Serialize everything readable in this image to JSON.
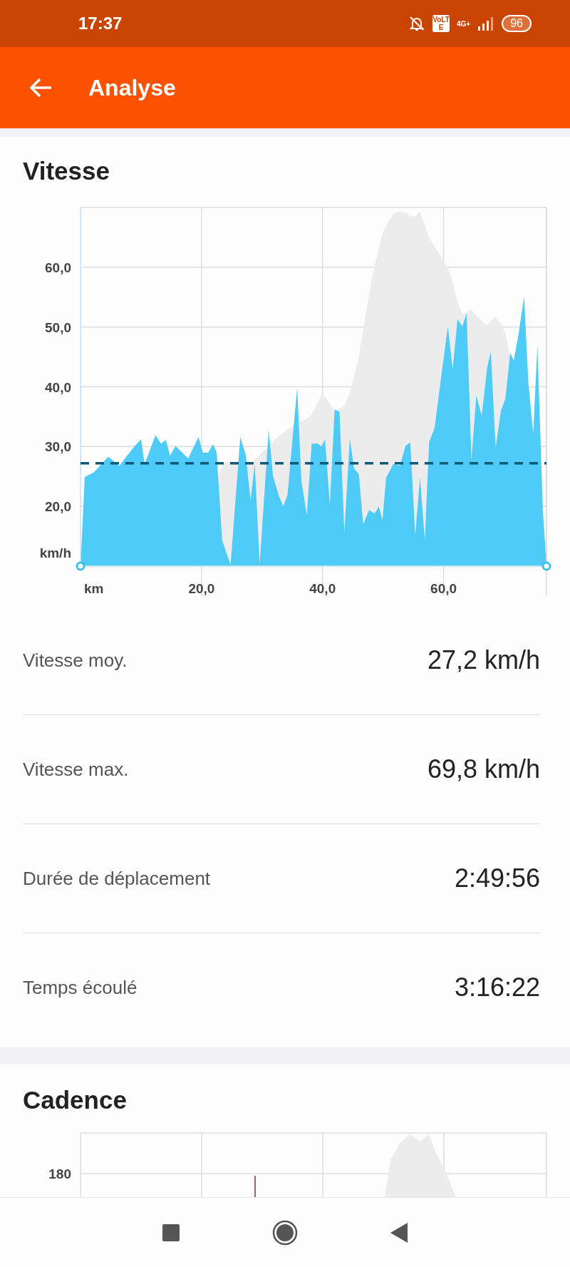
{
  "status_bar": {
    "time": "17:37",
    "volte": "VoLTE",
    "network": "4G+",
    "battery": "96"
  },
  "app_bar": {
    "title": "Analyse"
  },
  "speed": {
    "title": "Vitesse",
    "chart_data": {
      "type": "area",
      "xlabel": "km",
      "ylabel": "km/h",
      "xlim": [
        0,
        77
      ],
      "ylim": [
        10,
        70
      ],
      "xticks": [
        {
          "value": 20,
          "label": "20,0"
        },
        {
          "value": 40,
          "label": "40,0"
        },
        {
          "value": 60,
          "label": "60,0"
        }
      ],
      "yticks": [
        {
          "value": 20,
          "label": "20,0"
        },
        {
          "value": 30,
          "label": "30,0"
        },
        {
          "value": 40,
          "label": "40,0"
        },
        {
          "value": 50,
          "label": "50,0"
        },
        {
          "value": 60,
          "label": "60,0"
        }
      ],
      "x": [
        0,
        0.7,
        2.2,
        4.6,
        6.4,
        8.8,
        10,
        10.6,
        12.4,
        13.3,
        14.1,
        14.8,
        15.7,
        17.8,
        19.5,
        20.2,
        21.1,
        21.9,
        22.5,
        23.4,
        24.8,
        26.4,
        27.3,
        28.1,
        28.8,
        29.6,
        31.1,
        31.8,
        32.8,
        33.5,
        34.2,
        35.8,
        36.5,
        37.4,
        38.2,
        39.2,
        39.8,
        40.4,
        41.2,
        42,
        42.8,
        43.6,
        44.5,
        45.2,
        46,
        46.7,
        47.7,
        48.6,
        49.3,
        49.9,
        50.5,
        51.7,
        52.8,
        53.7,
        54.5,
        55.3,
        56.1,
        56.9,
        57.6,
        58.5,
        60.7,
        61.5,
        62.3,
        63.1,
        63.8,
        64.6,
        65.4,
        66.3,
        67.2,
        67.8,
        68.6,
        69.5,
        70.2,
        71,
        71.6,
        72.3,
        73.3,
        74,
        74.8,
        75.5,
        76.4,
        77
      ],
      "series": [
        {
          "color": "#44c8f5",
          "values": [
            10,
            24.9,
            25.7,
            28.3,
            26.8,
            29.9,
            31.2,
            27.1,
            31.9,
            30.5,
            31.1,
            28.5,
            30.1,
            28,
            31.6,
            29,
            29,
            30.4,
            29,
            14.3,
            10.2,
            31.6,
            28.6,
            20.9,
            27.1,
            10.2,
            32.8,
            25.1,
            21.7,
            20,
            21.9,
            39.9,
            24.2,
            18.5,
            30.5,
            30.5,
            30,
            31.2,
            20.3,
            36.2,
            35.8,
            15.5,
            31.4,
            26.3,
            25.4,
            17,
            19.4,
            18.8,
            20,
            17.7,
            24.8,
            27.1,
            26.8,
            30.1,
            30.7,
            15.2,
            24.8,
            14.3,
            30.7,
            33.1,
            50.1,
            42.9,
            51.3,
            50.1,
            52.3,
            27.7,
            38.5,
            35.2,
            43.2,
            45.9,
            29.8,
            36.1,
            37.9,
            45.6,
            44.4,
            48.3,
            55.1,
            40.8,
            32.2,
            46.9,
            19.4,
            10.2
          ]
        },
        {
          "color": "#ececec",
          "values": [
            null,
            null,
            null,
            null,
            null,
            null,
            null,
            null,
            null,
            null,
            null,
            null,
            null,
            null,
            null,
            null,
            null,
            null,
            24,
            27,
            27.6,
            27,
            27,
            27.1,
            27.8,
            28.6,
            30.1,
            30.8,
            31.8,
            32.3,
            32.8,
            33.9,
            34.2,
            34.7,
            35.4,
            37.4,
            38.6,
            38.4,
            37.2,
            36,
            36.4,
            36.8,
            39,
            41.8,
            45,
            49.5,
            55.5,
            60.4,
            63.2,
            65.6,
            66.9,
            69,
            69.4,
            69.2,
            68.5,
            68.5,
            69.3,
            67,
            65,
            63.5,
            59.9,
            57.5,
            54.2,
            52.2,
            52.5,
            52.9,
            51.9,
            51,
            50.3,
            51.1,
            51.7,
            50.5,
            49,
            45,
            null,
            null,
            null,
            null,
            null,
            null,
            null,
            null
          ]
        }
      ],
      "ref_lines": [
        {
          "axis": "y",
          "value": 27.2
        }
      ],
      "grid": true
    }
  },
  "stats": [
    {
      "label": "Vitesse moy.",
      "value": "27,2 km/h"
    },
    {
      "label": "Vitesse max.",
      "value": "69,8 km/h"
    },
    {
      "label": "Durée de déplacement",
      "value": "2:49:56"
    },
    {
      "label": "Temps écoulé",
      "value": "3:16:22"
    }
  ],
  "cadence": {
    "title": "Cadence",
    "tick": "180"
  }
}
